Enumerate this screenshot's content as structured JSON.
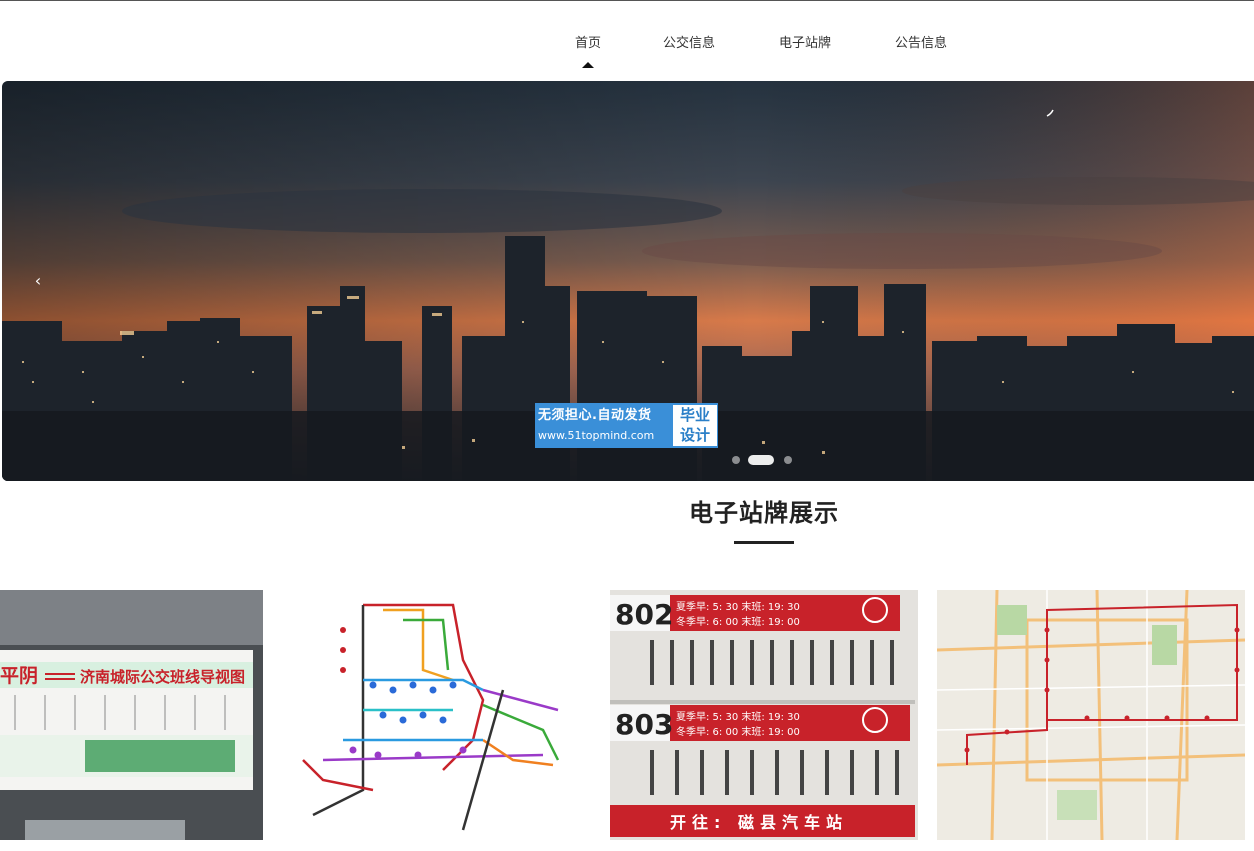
{
  "nav": {
    "items": [
      {
        "label": "首页",
        "active": true
      },
      {
        "label": "公交信息",
        "active": false
      },
      {
        "label": "电子站牌",
        "active": false
      },
      {
        "label": "公告信息",
        "active": false
      }
    ]
  },
  "banner": {
    "prev_icon": "chevron-left-icon",
    "watermark": {
      "line1": "无须担心.自动发货",
      "line2": "www.51topmind.com",
      "badge_line1": "毕业",
      "badge_line2": "设计"
    }
  },
  "section": {
    "title": "电子站牌展示"
  },
  "cards": [
    {
      "sign_title": "平阴",
      "sign_subtitle": "济南城际公交班线导视图"
    },
    {
      "map": "route-map"
    },
    {
      "route_a": "802",
      "route_a_line1": "夏季早: 5: 30 末班: 19: 30",
      "route_a_line2": "冬季早: 6: 00 末班: 19: 00",
      "route_b": "803",
      "route_b_line1": "夏季早: 5: 30 末班: 19: 30",
      "route_b_line2": "冬季早: 6: 00 末班: 19: 00",
      "footer": "开往: 磁县汽车站"
    },
    {
      "map": "city-map"
    }
  ],
  "colors": {
    "accent": "#3a8fd8",
    "sign_red": "#c8222a",
    "sunset": "#e8743a"
  }
}
